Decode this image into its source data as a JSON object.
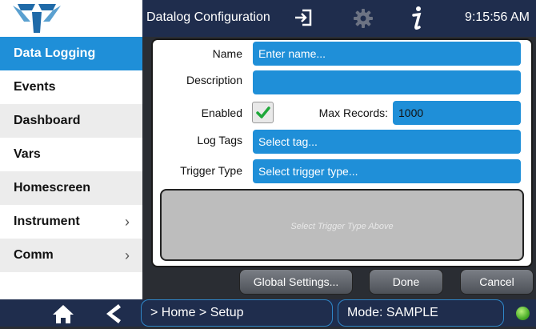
{
  "header": {
    "title": "Datalog Configuration",
    "time": "9:15:56 AM",
    "icons": [
      "logout-icon",
      "gear-icon",
      "info-icon"
    ]
  },
  "sidebar": {
    "items": [
      {
        "label": "Data Logging",
        "active": true,
        "submenu": false
      },
      {
        "label": "Events",
        "active": false,
        "submenu": false
      },
      {
        "label": "Dashboard",
        "active": false,
        "submenu": false
      },
      {
        "label": "Vars",
        "active": false,
        "submenu": false
      },
      {
        "label": "Homescreen",
        "active": false,
        "submenu": false
      },
      {
        "label": "Instrument",
        "active": false,
        "submenu": true
      },
      {
        "label": "Comm",
        "active": false,
        "submenu": true
      }
    ],
    "chevron": "›"
  },
  "form": {
    "name_label": "Name",
    "name_placeholder": "Enter name...",
    "description_label": "Description",
    "description_value": "",
    "enabled_label": "Enabled",
    "enabled_checked": true,
    "max_records_label": "Max Records:",
    "max_records_value": "1000",
    "log_tags_label": "Log Tags",
    "log_tags_placeholder": "Select tag...",
    "trigger_type_label": "Trigger Type",
    "trigger_type_placeholder": "Select trigger type...",
    "trigger_hint": "Select Trigger Type Above"
  },
  "buttons": {
    "global_settings": "Global Settings...",
    "done": "Done",
    "cancel": "Cancel"
  },
  "footer": {
    "breadcrumb": "> Home > Setup",
    "mode": "Mode: SAMPLE",
    "status_color": "#4caf2a"
  },
  "colors": {
    "accent": "#1f8fd8",
    "header": "#1f2d4d"
  }
}
